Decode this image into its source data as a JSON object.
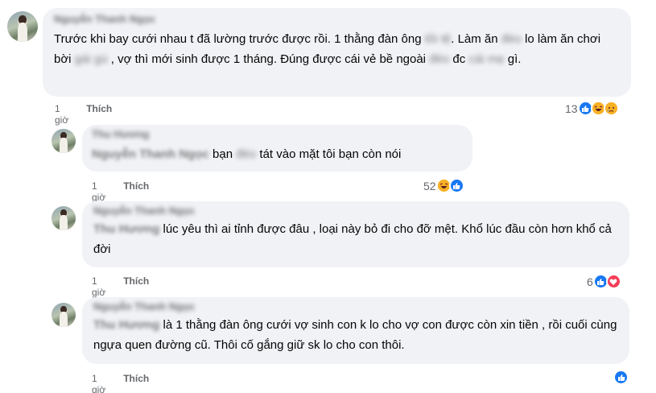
{
  "comments": [
    {
      "author": "Nguyễn Thanh Ngọc",
      "text_parts": [
        "Trước khi bay cưới nhau t đã lường trước được rồi. 1 thằng đàn ông ",
        "tồi tệ",
        ". Làm ăn ",
        "đéo",
        " lo làm ăn chơi bời ",
        "gái gú",
        " , vợ thì mới sinh được 1 tháng. Đúng được cái vẻ bề ngoài ",
        "đéo",
        " đc ",
        "cái mẹ",
        " gì."
      ],
      "time": "1 giờ",
      "like_label": "Thích",
      "reaction_count": "13",
      "reactions": [
        "like",
        "haha",
        "sad"
      ]
    },
    {
      "author": "Thu Hương",
      "mention": "Nguyễn Thanh Ngọc",
      "text_parts": [
        " bạn ",
        "đéo",
        " tát vào mặt tôi bạn còn nói"
      ],
      "time": "1 giờ",
      "like_label": "Thích",
      "reaction_count": "52",
      "reactions": [
        "haha",
        "like"
      ]
    },
    {
      "author": "Nguyễn Thanh Ngọc",
      "mention": "Thu Hương",
      "text_parts": [
        " lúc yêu thì ai tỉnh được đâu , loại này bỏ đi cho đỡ mệt. Khổ lúc đầu còn hơn khổ cả đời"
      ],
      "time": "1 giờ",
      "like_label": "Thích",
      "reaction_count": "6",
      "reactions": [
        "like",
        "love"
      ]
    },
    {
      "author": "Nguyễn Thanh Ngọc",
      "mention": "Thu Hương",
      "text_parts": [
        " là 1 thằng đàn ông cưới vợ sinh con k lo cho vợ con được còn xin tiền , rồi cuối cùng ngựa quen đường cũ. Thôi cố gắng giữ sk lo cho con thôi."
      ],
      "time": "1 giờ",
      "like_label": "Thích",
      "reaction_count": "",
      "reactions": [
        "like"
      ]
    }
  ]
}
